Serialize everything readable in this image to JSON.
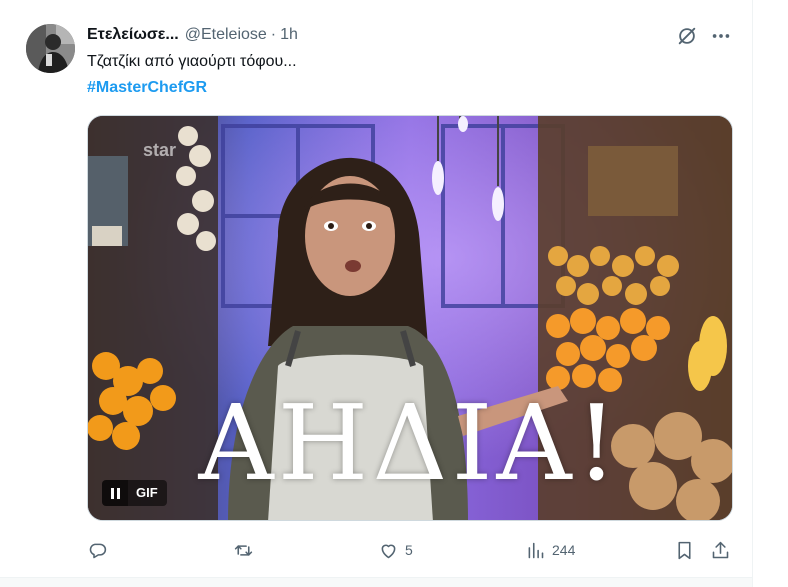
{
  "tweet": {
    "display_name": "Ετελείωσε...",
    "handle": "@Eteleiose",
    "separator": "·",
    "time": "1h",
    "text": "Τζατζίκι από γιαούρτι τόφου...",
    "hashtag": "#MasterChefGR"
  },
  "media": {
    "caption": "ΑΗΔΙΑ!",
    "gif_badge": "GIF"
  },
  "actions": {
    "replies": "",
    "retweets": "",
    "likes": "5",
    "views": "244"
  },
  "icons": {
    "avatar": "avatar-photo",
    "grok": "grok-slash-icon",
    "more": "more-dots-icon",
    "reply": "reply-bubble-icon",
    "retweet": "retweet-icon",
    "like": "heart-icon",
    "views": "analytics-bars-icon",
    "bookmark": "bookmark-icon",
    "share": "share-upload-icon",
    "pause": "pause-icon"
  },
  "colors": {
    "text_primary": "#0f1419",
    "text_secondary": "#536471",
    "link_blue": "#1d9bf0",
    "border": "#eff3f4"
  }
}
